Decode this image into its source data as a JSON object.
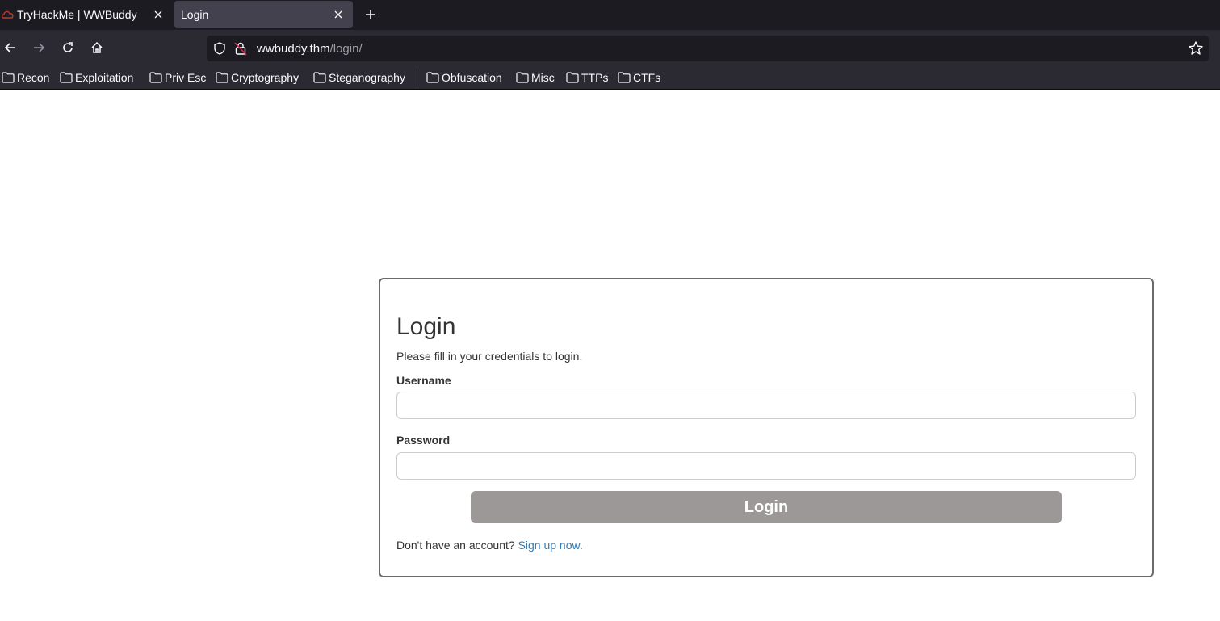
{
  "browser": {
    "tabs": [
      {
        "title": "TryHackMe | WWBuddy",
        "active": false
      },
      {
        "title": "Login",
        "active": true
      }
    ],
    "url": {
      "host": "wwbuddy.thm",
      "path": "/login/"
    },
    "bookmarks": [
      "Recon",
      "Exploitation",
      "Priv Esc",
      "Cryptography",
      "Steganography",
      "Obfuscation",
      "Misc",
      "TTPs",
      "CTFs"
    ]
  },
  "login": {
    "title": "Login",
    "subtitle": "Please fill in your credentials to login.",
    "username_label": "Username",
    "username_value": "",
    "password_label": "Password",
    "password_value": "",
    "submit_label": "Login",
    "signup_prompt": "Don't have an account?",
    "signup_link": "Sign up now",
    "signup_suffix": "."
  },
  "colors": {
    "tab_bar": "#1c1b22",
    "toolbar": "#2b2a33",
    "active_tab": "#42414d",
    "button_bg": "#9c9898",
    "link": "#337ab7"
  }
}
